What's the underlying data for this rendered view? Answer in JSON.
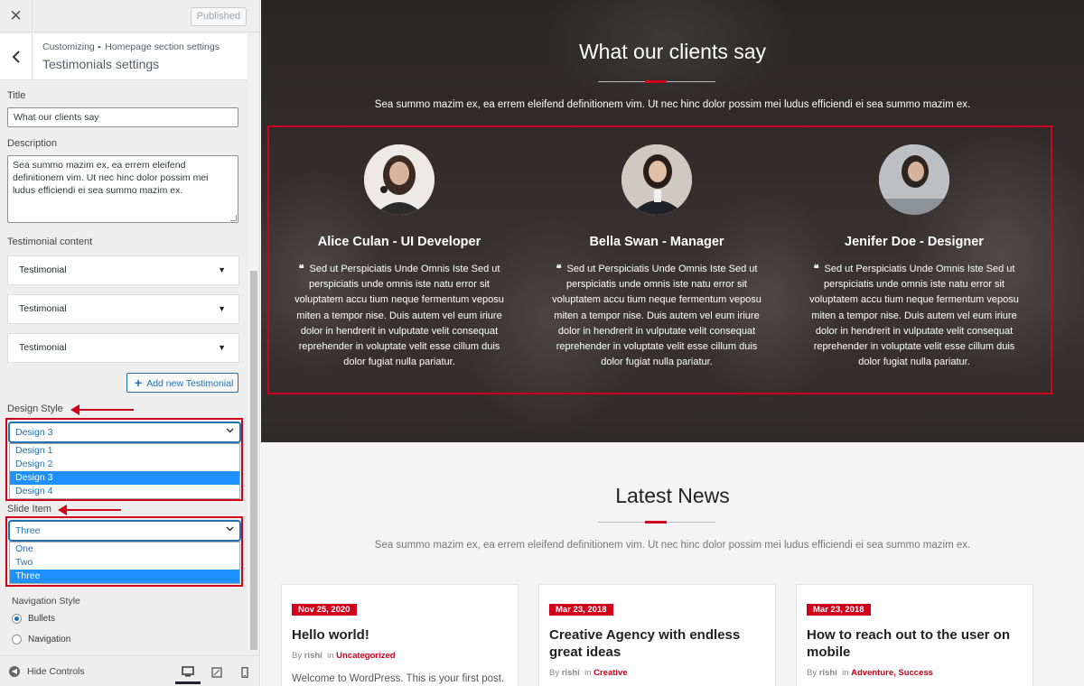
{
  "sidebar": {
    "published_label": "Published",
    "breadcrumb": {
      "root": "Customizing",
      "parent": "Homepage section settings"
    },
    "section_title": "Testimonials settings",
    "title_label": "Title",
    "title_value": "What our clients say",
    "description_label": "Description",
    "description_value": "Sea summo mazim ex, ea errem eleifend definitionem vim. Ut nec hinc dolor possim mei ludus efficiendi ei sea summo mazim ex.",
    "content_label": "Testimonial content",
    "items": [
      "Testimonial",
      "Testimonial",
      "Testimonial"
    ],
    "add_label": "Add new Testimonial",
    "design_style_label": "Design Style",
    "design_style_value": "Design 3",
    "design_options": [
      "Design 1",
      "Design 2",
      "Design 3",
      "Design 4"
    ],
    "slide_item_label": "Slide Item",
    "slide_item_value": "Three",
    "slide_options": [
      "One",
      "Two",
      "Three"
    ],
    "nav_style_label": "Navigation Style",
    "nav_options": [
      "Bullets",
      "Navigation"
    ],
    "nav_selected": "Bullets",
    "hide_controls_label": "Hide Controls"
  },
  "preview": {
    "testimonials": {
      "title": "What our clients say",
      "subtitle": "Sea summo mazim ex, ea errem eleifend definitionem vim. Ut nec hinc dolor possim mei ludus efficiendi ei sea summo mazim ex.",
      "items": [
        {
          "name": "Alice Culan - UI Developer",
          "text": "Sed ut Perspiciatis Unde Omnis Iste Sed ut perspiciatis unde omnis iste natu error sit voluptatem accu tium neque fermentum veposu miten a tempor nise. Duis autem vel eum iriure dolor in hendrerit in vulputate velit consequat reprehender in voluptate velit esse cillum duis dolor fugiat nulla pariatur."
        },
        {
          "name": "Bella Swan - Manager",
          "text": "Sed ut Perspiciatis Unde Omnis Iste Sed ut perspiciatis unde omnis iste natu error sit voluptatem accu tium neque fermentum veposu miten a tempor nise. Duis autem vel eum iriure dolor in hendrerit in vulputate velit consequat reprehender in voluptate velit esse cillum duis dolor fugiat nulla pariatur."
        },
        {
          "name": "Jenifer Doe - Designer",
          "text": "Sed ut Perspiciatis Unde Omnis Iste Sed ut perspiciatis unde omnis iste natu error sit voluptatem accu tium neque fermentum veposu miten a tempor nise. Duis autem vel eum iriure dolor in hendrerit in vulputate velit consequat reprehender in voluptate velit esse cillum duis dolor fugiat nulla pariatur."
        }
      ]
    },
    "news": {
      "title": "Latest News",
      "subtitle": "Sea summo mazim ex, ea errem eleifend definitionem vim. Ut nec hinc dolor possim mei ludus efficiendi ei sea summo mazim ex.",
      "posts": [
        {
          "date": "Nov 25, 2020",
          "title": "Hello world!",
          "by": "By",
          "author": "rishi",
          "in": "in",
          "categories": "Uncategorized",
          "excerpt": "Welcome to WordPress. This is your first post."
        },
        {
          "date": "Mar 23, 2018",
          "title": "Creative Agency with endless great ideas",
          "by": "By",
          "author": "rishi",
          "in": "in",
          "categories": "Creative",
          "excerpt": ""
        },
        {
          "date": "Mar 23, 2018",
          "title": "How to reach out to the user on mobile",
          "by": "By",
          "author": "rishi",
          "in": "in",
          "categories": "Adventure, Success",
          "excerpt": ""
        }
      ]
    }
  },
  "colors": {
    "accent": "#d0021b",
    "wp_blue": "#2271b1",
    "selected_option": "#1e90ff"
  },
  "icons": [
    "close-icon",
    "back-icon",
    "plus-icon",
    "chevron-down-icon",
    "desktop-icon",
    "tablet-icon",
    "mobile-icon",
    "hide-controls-icon",
    "quote-icon"
  ]
}
